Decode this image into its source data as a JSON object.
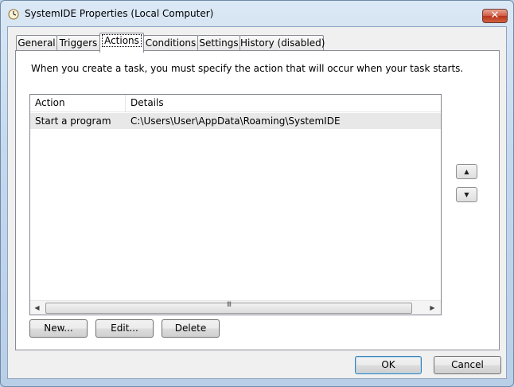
{
  "window": {
    "title": "SystemIDE Properties (Local Computer)",
    "close_glyph": "✕"
  },
  "tabs": [
    {
      "label": "General"
    },
    {
      "label": "Triggers"
    },
    {
      "label": "Actions"
    },
    {
      "label": "Conditions"
    },
    {
      "label": "Settings"
    },
    {
      "label": "History (disabled)"
    }
  ],
  "actions": {
    "intro": "When you create a task, you must specify the action that will occur when your task starts.",
    "columns": [
      "Action",
      "Details"
    ],
    "rows": [
      {
        "action": "Start a program",
        "details": "C:\\Users\\User\\AppData\\Roaming\\SystemIDE"
      }
    ],
    "scroll": {
      "left": "◀",
      "right": "▶",
      "grip": "III"
    },
    "move_up": "▲",
    "move_down": "▼",
    "buttons": {
      "new": "New...",
      "edit": "Edit...",
      "delete": "Delete"
    }
  },
  "footer": {
    "ok": "OK",
    "cancel": "Cancel"
  }
}
